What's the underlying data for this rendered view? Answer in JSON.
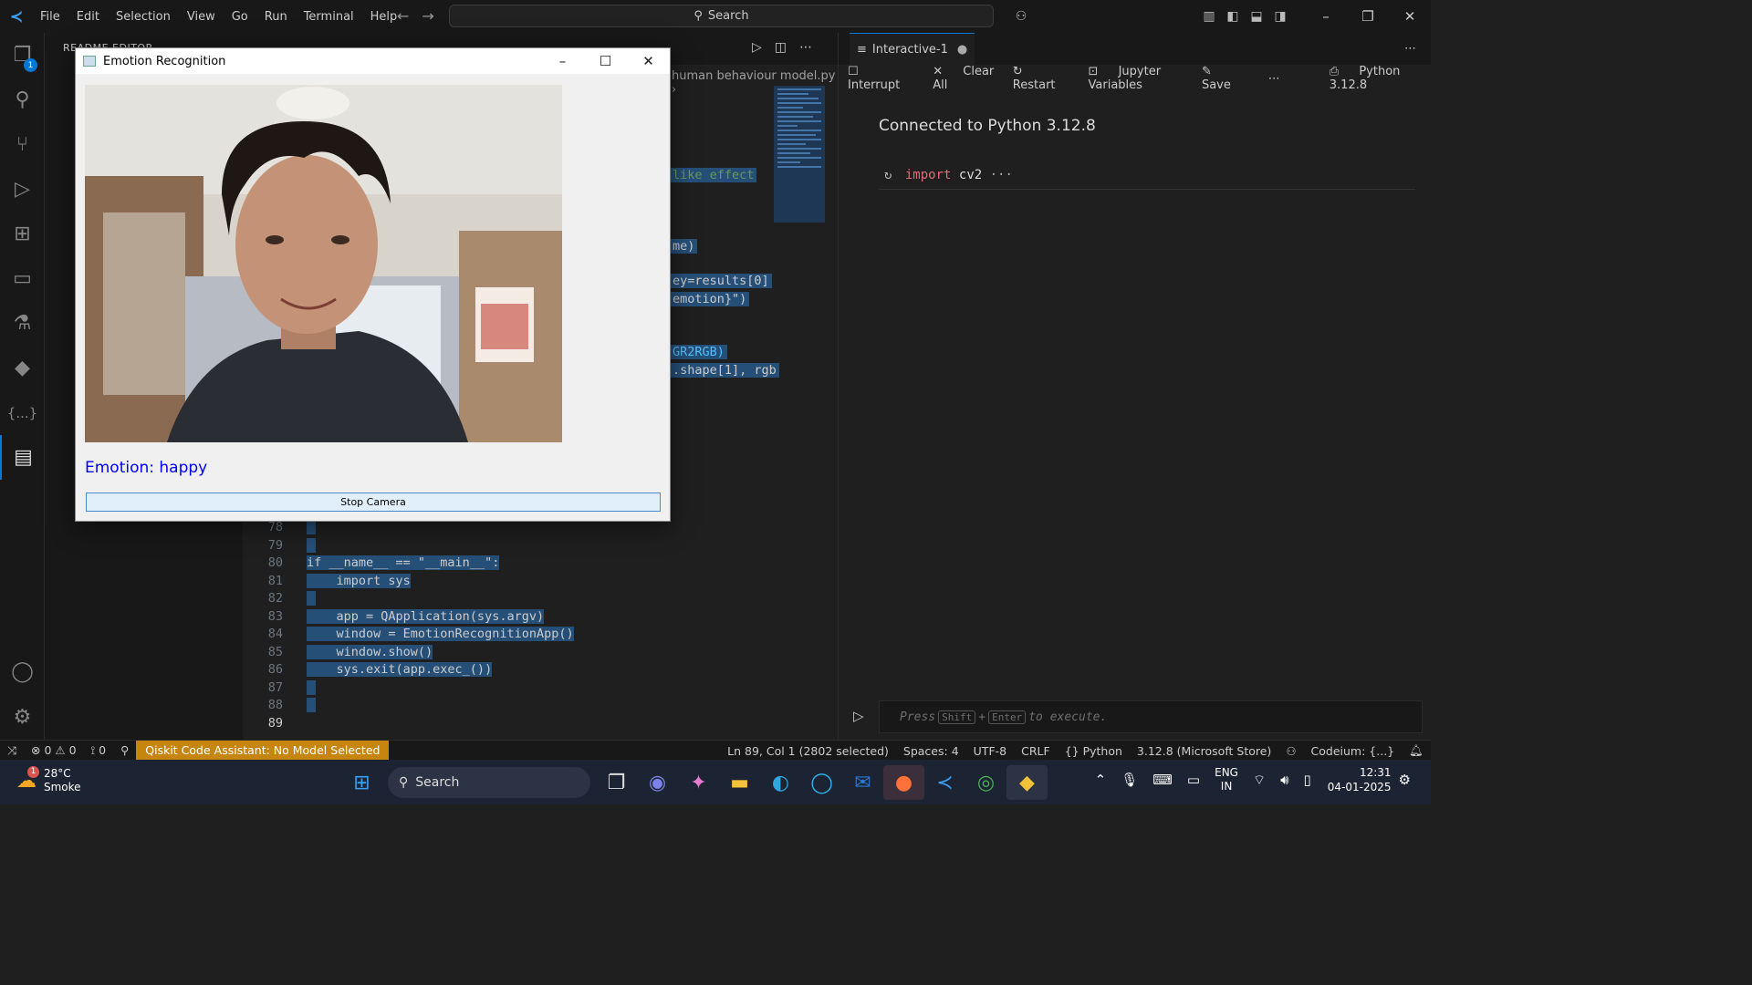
{
  "titlebar": {
    "menus": [
      "File",
      "Edit",
      "Selection",
      "View",
      "Go",
      "Run",
      "Terminal",
      "Help"
    ],
    "search": "Search"
  },
  "sidebar": {
    "header": "README EDITOR"
  },
  "editor": {
    "breadcrumb": "human behaviour model.py",
    "code": [
      {
        "n": "78",
        "t": ""
      },
      {
        "n": "79",
        "t": ""
      },
      {
        "n": "80",
        "t": "if __name__ == \"__main__\":"
      },
      {
        "n": "81",
        "t": "    import sys"
      },
      {
        "n": "82",
        "t": ""
      },
      {
        "n": "83",
        "t": "    app = QApplication(sys.argv)"
      },
      {
        "n": "84",
        "t": "    window = EmotionRecognitionApp()"
      },
      {
        "n": "85",
        "t": "    window.show()"
      },
      {
        "n": "86",
        "t": "    sys.exit(app.exec_())"
      },
      {
        "n": "87",
        "t": ""
      },
      {
        "n": "88",
        "t": ""
      },
      {
        "n": "89",
        "t": ""
      }
    ],
    "fragments": [
      "like effect",
      "me)",
      "ey=results[0]",
      "emotion}\")",
      "GR2RGB)",
      ".shape[1], rgb"
    ]
  },
  "panel": {
    "tab": "Interactive-1",
    "toolbar": {
      "interrupt": "Interrupt",
      "clear": "Clear All",
      "restart": "Restart",
      "variables": "Jupyter Variables",
      "save": "Save",
      "kernel": "Python 3.12.8"
    },
    "connected": "Connected to Python 3.12.8",
    "cell_kw": "import",
    "cell_mod": "cv2",
    "cell_more": "···",
    "input_press": "Press",
    "input_shift": "Shift",
    "input_enter": "Enter",
    "input_rest": "to execute."
  },
  "app": {
    "title": "Emotion Recognition",
    "emotion": "Emotion: happy",
    "button": "Stop Camera"
  },
  "status": {
    "errors": "0",
    "warnings": "0",
    "ports": "0",
    "qiskit": "Qiskit Code Assistant: No Model Selected",
    "position": "Ln 89, Col 1 (2802 selected)",
    "spaces": "Spaces: 4",
    "encoding": "UTF-8",
    "eol": "CRLF",
    "language": "Python",
    "interpreter": "3.12.8 (Microsoft Store)",
    "codeium": "Codeium: {...}"
  },
  "taskbar": {
    "temp": "28°C",
    "weather": "Smoke",
    "weather_badge": "1",
    "search": "Search",
    "lang1": "ENG",
    "lang2": "IN",
    "time": "12:31",
    "date": "04-01-2025"
  }
}
